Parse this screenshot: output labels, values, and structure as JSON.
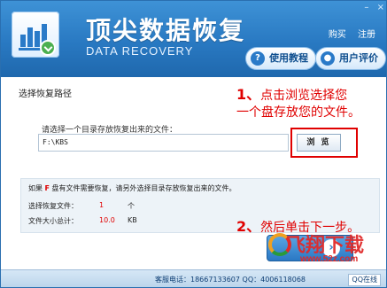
{
  "header": {
    "title_cn": "顶尖数据恢复",
    "title_en": "DATA RECOVERY",
    "nav": [
      "购买",
      "注册"
    ],
    "help_button": "使用教程",
    "review_button": "用户评价"
  },
  "main": {
    "step_title": "选择恢复路径",
    "annotation_1_num": "1、",
    "annotation_1_line1": "点击浏览选择您",
    "annotation_1_line2": "一个盘存放您的文件。",
    "prompt": "请选择一个目录存放恢复出来的文件：",
    "path_value": "F:\\KBS",
    "browse_button": "浏 览",
    "info": {
      "line": "如果 F 盘有文件需要恢复，请另外选择目录存放恢复出来的文件。",
      "line_prefix": "如果 ",
      "line_drive": "F",
      "line_suffix": " 盘有文件需要恢复，请另外选择目录存放恢复出来的文件。",
      "files_label": "选择恢复文件：",
      "files_value": "1",
      "files_unit": "个",
      "size_label": "文件大小总计：",
      "size_value": "10.0",
      "size_unit": "KB"
    },
    "annotation_2_num": "2、",
    "annotation_2_text": "然后单击下一步。"
  },
  "watermark": {
    "text": "飞翔下载",
    "url": "www.52z.com"
  },
  "footer": {
    "text": "客服电话：18667133607  QQ：4006118068",
    "qq_badge": "QQ在线"
  }
}
